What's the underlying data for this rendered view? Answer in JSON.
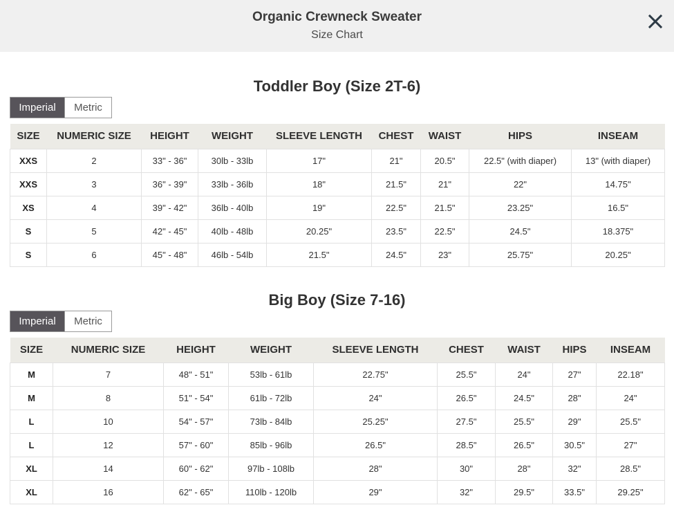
{
  "header": {
    "title": "Organic Crewneck Sweater",
    "subtitle": "Size Chart"
  },
  "toddler": {
    "title": "Toddler Boy (Size 2T-6)",
    "toggle": {
      "imperial": "Imperial",
      "metric": "Metric",
      "selected": "Imperial"
    },
    "columns": [
      "SIZE",
      "NUMERIC SIZE",
      "HEIGHT",
      "WEIGHT",
      "SLEEVE LENGTH",
      "CHEST",
      "WAIST",
      "HIPS",
      "INSEAM"
    ],
    "rows": [
      [
        "XXS",
        "2",
        "33\" - 36\"",
        "30lb - 33lb",
        "17\"",
        "21\"",
        "20.5\"",
        "22.5\" (with diaper)",
        "13\" (with diaper)"
      ],
      [
        "XXS",
        "3",
        "36\" - 39\"",
        "33lb - 36lb",
        "18\"",
        "21.5\"",
        "21\"",
        "22\"",
        "14.75\""
      ],
      [
        "XS",
        "4",
        "39\" - 42\"",
        "36lb - 40lb",
        "19\"",
        "22.5\"",
        "21.5\"",
        "23.25\"",
        "16.5\""
      ],
      [
        "S",
        "5",
        "42\" - 45\"",
        "40lb - 48lb",
        "20.25\"",
        "23.5\"",
        "22.5\"",
        "24.5\"",
        "18.375\""
      ],
      [
        "S",
        "6",
        "45\" - 48\"",
        "46lb - 54lb",
        "21.5\"",
        "24.5\"",
        "23\"",
        "25.75\"",
        "20.25\""
      ]
    ]
  },
  "bigboy": {
    "title": "Big Boy (Size 7-16)",
    "toggle": {
      "imperial": "Imperial",
      "metric": "Metric",
      "selected": "Imperial"
    },
    "columns": [
      "SIZE",
      "NUMERIC SIZE",
      "HEIGHT",
      "WEIGHT",
      "SLEEVE LENGTH",
      "CHEST",
      "WAIST",
      "HIPS",
      "INSEAM"
    ],
    "rows": [
      [
        "M",
        "7",
        "48\" - 51\"",
        "53lb - 61lb",
        "22.75\"",
        "25.5\"",
        "24\"",
        "27\"",
        "22.18\""
      ],
      [
        "M",
        "8",
        "51\" - 54\"",
        "61lb - 72lb",
        "24\"",
        "26.5\"",
        "24.5\"",
        "28\"",
        "24\""
      ],
      [
        "L",
        "10",
        "54\" - 57\"",
        "73lb - 84lb",
        "25.25\"",
        "27.5\"",
        "25.5\"",
        "29\"",
        "25.5\""
      ],
      [
        "L",
        "12",
        "57\" - 60\"",
        "85lb - 96lb",
        "26.5\"",
        "28.5\"",
        "26.5\"",
        "30.5\"",
        "27\""
      ],
      [
        "XL",
        "14",
        "60\" - 62\"",
        "97lb - 108lb",
        "28\"",
        "30\"",
        "28\"",
        "32\"",
        "28.5\""
      ],
      [
        "XL",
        "16",
        "62\" - 65\"",
        "110lb - 120lb",
        "29\"",
        "32\"",
        "29.5\"",
        "33.5\"",
        "29.25\""
      ]
    ]
  },
  "icons": {
    "close": "close-icon"
  },
  "colors": {
    "header_bg": "#f0f0f0",
    "toggle_active": "#57545a",
    "table_header_bg": "#ecebe6"
  }
}
